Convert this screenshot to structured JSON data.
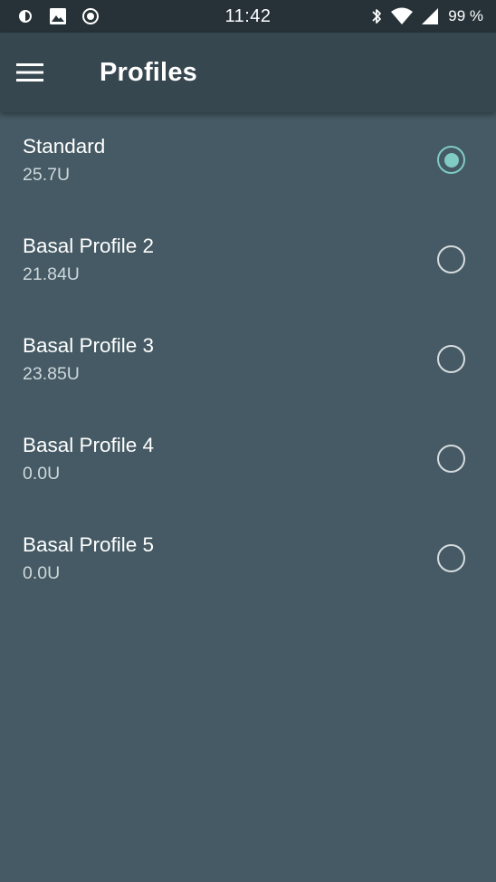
{
  "status_bar": {
    "time": "11:42",
    "battery": "99 %",
    "left_icons": [
      "data-saver-icon",
      "image-icon",
      "record-icon"
    ],
    "right_icons": [
      "bluetooth-icon",
      "wifi-icon",
      "cell-signal-icon"
    ]
  },
  "app_bar": {
    "menu_icon": "hamburger-menu-icon",
    "title": "Profiles"
  },
  "colors": {
    "status_bar_bg": "#263238",
    "app_bar_bg": "#37474f",
    "content_bg": "#455a64",
    "accent": "#80cbc4"
  },
  "profiles": [
    {
      "name": "Standard",
      "total": "25.7U",
      "selected": true
    },
    {
      "name": "Basal Profile 2",
      "total": "21.84U",
      "selected": false
    },
    {
      "name": "Basal Profile 3",
      "total": "23.85U",
      "selected": false
    },
    {
      "name": "Basal Profile 4",
      "total": "0.0U",
      "selected": false
    },
    {
      "name": "Basal Profile 5",
      "total": "0.0U",
      "selected": false
    }
  ]
}
